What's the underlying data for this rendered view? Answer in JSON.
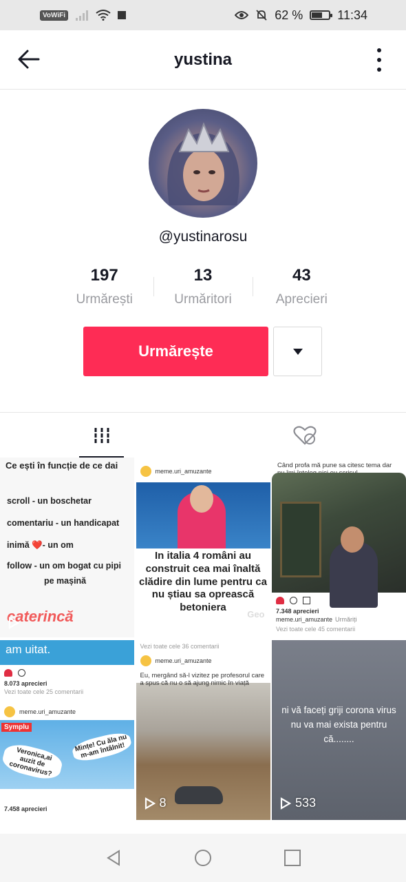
{
  "status_bar": {
    "left_badge": "VoWiFi",
    "battery": "62 %",
    "battery_level": 0.62,
    "time": "11:34"
  },
  "header": {
    "title": "yustina"
  },
  "profile": {
    "handle": "@yustinarosu",
    "stats": [
      {
        "value": "197",
        "label": "Urmărești"
      },
      {
        "value": "13",
        "label": "Urmăritori"
      },
      {
        "value": "43",
        "label": "Aprecieri"
      }
    ],
    "follow_label": "Urmărește"
  },
  "grid": {
    "t1": {
      "caption": "Ce ești în funcție de ce dai",
      "lines": [
        "scroll - un boschetar",
        "comentariu - un handicapat",
        "inimă ❤️- un om",
        "follow - un om bogat cu pipi",
        "pe mașină"
      ],
      "brand": "caterincă",
      "bottom_text": "Pentru ca noi am uitat."
    },
    "t2": {
      "account": "meme.uri_amuzante",
      "headline": "In italia 4 români au construit cea mai înaltă clădire din lume pentru ca nu știau sa oprească betoniera",
      "logo": "Geo"
    },
    "t3": {
      "caption": "Când profa mă pune sa citesc tema dar nu îmi înțeleg nici eu scrisul",
      "likes": "7.348 aprecieri",
      "account": "meme.uri_amuzante",
      "follow_text": "Urmăriți",
      "comments": "Vezi toate cele 45 comentarii"
    },
    "t4": {
      "top_text": "am uitat.",
      "likes": "8.073 aprecieri",
      "comments": "Vezi toate cele 25 comentarii",
      "account": "meme.uri_amuzante",
      "left_text": "Veronica,ai auzit de coronavirus?",
      "right_text": "Mințe! Cu ăla nu m-am întâlnit!",
      "likes2": "7.458 aprecieri",
      "symplu": "Symplu"
    },
    "t5": {
      "comments": "Vezi toate cele 36 comentarii",
      "account": "meme.uri_amuzante",
      "caption": "Eu, mergând să-l vizitez pe profesorul care a spus că nu o să ajung nimic în viață",
      "plays": "8"
    },
    "t6": {
      "message": "ni vă faceți griji corona virus nu va mai exista pentru că........",
      "plays": "533"
    }
  }
}
